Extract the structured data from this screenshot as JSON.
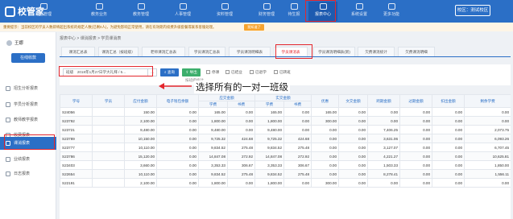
{
  "app": {
    "name": "校管家",
    "campus": "校区：测试校区"
  },
  "nav": [
    {
      "label": "招生管理",
      "icon": "recruit-icon"
    },
    {
      "label": "教务业务",
      "icon": "academic-icon"
    },
    {
      "label": "教务管理",
      "icon": "teaching-icon"
    },
    {
      "label": "人事管理",
      "icon": "hr-icon"
    },
    {
      "label": "资料管理",
      "icon": "files-icon"
    },
    {
      "label": "财务管理",
      "icon": "finance-icon"
    },
    {
      "label": "待生报",
      "icon": "pending-icon"
    },
    {
      "label": "报表中心",
      "icon": "report-icon",
      "active": true
    },
    {
      "label": "系统设置",
      "icon": "settings-icon"
    },
    {
      "label": "更多功能",
      "icon": "more-icon"
    }
  ],
  "notice": {
    "text": "重要提示：当前校区的学员人数即将超出系统的规定人数(已剩0人)，为避免影响正常使用，请在有效期内续费升级套餐或联系客服处理。",
    "button": "我知道了"
  },
  "user": {
    "name": "王娜"
  },
  "sidebar": {
    "receive_button": "在线收款",
    "items": [
      {
        "label": "招生分析报表",
        "icon": "analysis-icon"
      },
      {
        "label": "学员分析报表",
        "icon": "student-icon"
      },
      {
        "label": "教师教学报表",
        "icon": "teacher-icon"
      },
      {
        "label": "收费报表",
        "icon": "fee-icon"
      },
      {
        "label": "课消报表",
        "icon": "class-icon",
        "active": true
      },
      {
        "label": "业绩报表",
        "icon": "performance-icon"
      },
      {
        "label": "日志报表",
        "icon": "log-icon"
      }
    ]
  },
  "breadcrumb": "报表中心 > 课消报表 > 学员课消表",
  "tabs": [
    {
      "label": "课消汇总表"
    },
    {
      "label": "课消汇总（按班级）"
    },
    {
      "label": "老师课消汇总表"
    },
    {
      "label": "学员课消汇总表"
    },
    {
      "label": "学员课消明细表"
    },
    {
      "label": "学员课消表",
      "active": true
    },
    {
      "label": "学员课消明细表(新)"
    },
    {
      "label": "欠费课消统计"
    },
    {
      "label": "欠费课消明细"
    }
  ],
  "filter": {
    "class_label": "班级",
    "class_value": "2018年1月27日学大礼拜 / 5...",
    "more_label": "...",
    "query_button": "查询",
    "export_button": "导出",
    "checkbox_1": "停课",
    "checkbox_2": "已结业",
    "checkbox_3": "已退学",
    "checkbox_4": "已转班",
    "sub_label": "按班级统计",
    "hint": "有效课消时间为..."
  },
  "annotation": "选择所有的一对一班级",
  "table": {
    "group_headers": {
      "receivable": "应交金额",
      "paid": "实交金额"
    },
    "headers": [
      "学号",
      "学员",
      "应付金额",
      "电子钱包余额",
      "学费",
      "书费",
      "学费",
      "书费",
      "优惠",
      "文交金额",
      "跨期金额",
      "过期金额",
      "扣出金额",
      "剩余学费"
    ],
    "rows": [
      [
        "S24056",
        "",
        "150.00",
        "0.00",
        "165.00",
        "0.00",
        "165.00",
        "0.00",
        "165.00",
        "0.00",
        "0.00",
        "0.00",
        "0.00",
        "0.00"
      ],
      [
        "S23792",
        "",
        "2,100.00",
        "0.00",
        "1,800.00",
        "0.00",
        "1,800.00",
        "0.00",
        "300.00",
        "0.00",
        "0.00",
        "0.00",
        "0.00",
        "0.00"
      ],
      [
        "S23721",
        "",
        "9,480.00",
        "0.00",
        "9,480.00",
        "0.00",
        "9,480.00",
        "0.00",
        "0.00",
        "0.00",
        "7,406.25",
        "0.00",
        "0.00",
        "2,073.75"
      ],
      [
        "S23789",
        "",
        "10,150.00",
        "0.00",
        "9,725.32",
        "424.68",
        "9,725.32",
        "424.68",
        "0.00",
        "0.00",
        "3,631.06",
        "0.00",
        "0.00",
        "6,093.26"
      ],
      [
        "S23777",
        "",
        "10,110.00",
        "0.00",
        "9,834.52",
        "275.48",
        "9,834.52",
        "275.48",
        "0.00",
        "0.00",
        "3,127.07",
        "0.00",
        "0.00",
        "6,707.45"
      ],
      [
        "S23786",
        "",
        "15,120.00",
        "0.00",
        "14,847.08",
        "272.92",
        "14,847.08",
        "272.92",
        "0.00",
        "0.00",
        "4,221.27",
        "0.00",
        "0.00",
        "10,625.81"
      ],
      [
        "S23403",
        "",
        "3,660.00",
        "0.00",
        "3,353.33",
        "306.67",
        "3,353.33",
        "306.67",
        "0.00",
        "0.00",
        "1,503.33",
        "0.00",
        "0.00",
        "1,850.00"
      ],
      [
        "S22654",
        "",
        "10,110.00",
        "0.00",
        "9,834.52",
        "275.48",
        "9,834.52",
        "275.48",
        "0.00",
        "0.00",
        "8,278.41",
        "0.00",
        "0.00",
        "1,556.11"
      ],
      [
        "S22191",
        "",
        "2,100.00",
        "0.00",
        "1,800.00",
        "0.00",
        "1,800.00",
        "0.00",
        "300.00",
        "0.00",
        "0.00",
        "0.00",
        "0.00",
        "0.00"
      ]
    ]
  },
  "colors": {
    "primary": "#2b6fc6",
    "highlight": "#e3262d",
    "success": "#3cae6c",
    "warning": "#f7a42e"
  }
}
